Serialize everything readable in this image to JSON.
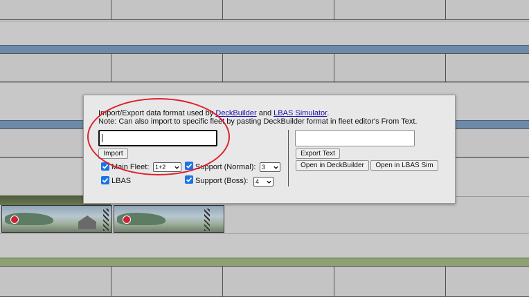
{
  "dialog": {
    "line1_prefix": "Import/Export data format used by",
    "deckbuilder_link": "DeckBuilder",
    "and_text": "and",
    "lbas_link": "LBAS Simulator",
    "line1_suffix": ".",
    "line2": "Note: Can also import to specific fleet by pasting DeckBuilder format in fleet editor's From Text.",
    "import_input_value": "",
    "import_button": "Import",
    "export_input_value": "",
    "export_button": "Export Text",
    "open_deckbuilder_button": "Open in DeckBuilder",
    "open_lbas_button": "Open in LBAS Sim",
    "main_fleet_label": "Main Fleet:",
    "main_fleet_value": "1+2",
    "main_fleet_checked": true,
    "support_normal_label": "Support (Normal):",
    "support_normal_value": "3",
    "support_normal_checked": true,
    "lbas_label": "LBAS",
    "lbas_checked": true,
    "support_boss_label": "Support (Boss):",
    "support_boss_value": "4",
    "support_boss_checked": true
  },
  "colors": {
    "accent": "#1a73e8",
    "annotation": "#e0202a",
    "band_blue": "#6e8aa9",
    "band_green": "#8ea173"
  }
}
